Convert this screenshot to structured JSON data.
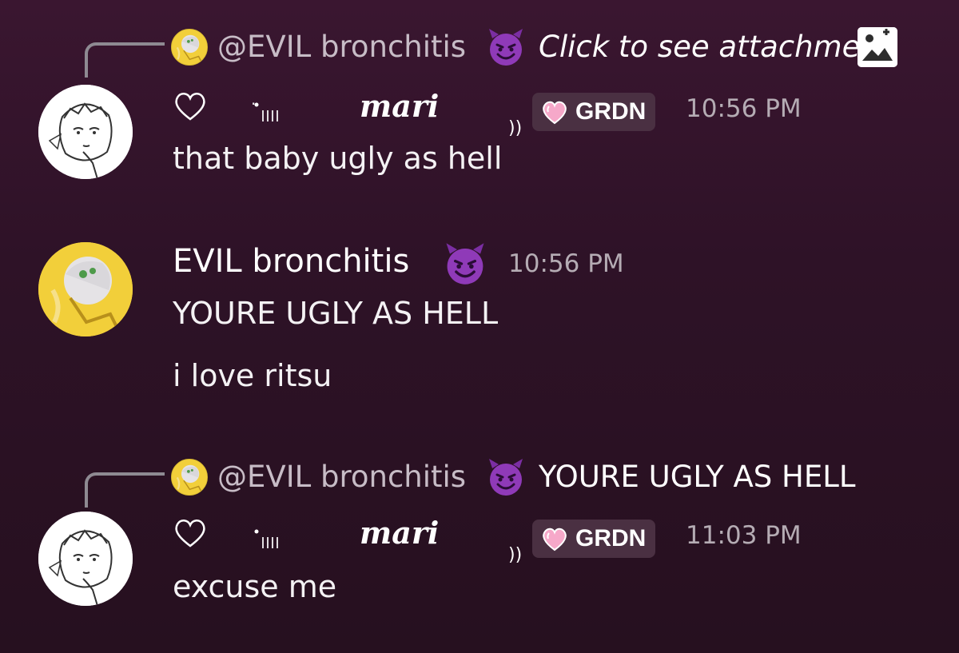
{
  "messages": [
    {
      "reply": {
        "user": "@EVIL bronchitis",
        "snippet": "Click to see attachme",
        "snippet_icon": "image-icon"
      },
      "author_name": "mari",
      "author_decorations": [
        "heart-outline-icon",
        "signal-bars-icon"
      ],
      "author_suffix": "))",
      "tag": {
        "emoji": "pink-heart-icon",
        "label": "GRDN"
      },
      "time": "10:56 PM",
      "text": "that baby ugly as hell"
    },
    {
      "author_name": "EVIL bronchitis",
      "author_emoji": "smiling-devil-icon",
      "time": "10:56 PM",
      "lines": [
        "YOURE UGLY AS HELL",
        "i love ritsu"
      ]
    },
    {
      "reply": {
        "user": "@EVIL bronchitis",
        "snippet": "YOURE UGLY AS HELL"
      },
      "author_name": "mari",
      "author_suffix": "))",
      "tag": {
        "emoji": "pink-heart-icon",
        "label": "GRDN"
      },
      "time": "11:03 PM",
      "text": "excuse me"
    }
  ],
  "colors": {
    "background": "#2e1227",
    "timestamp": "#b5acb4",
    "tag_bg": "#4a3042",
    "devil_purple": "#8f3ab8"
  }
}
